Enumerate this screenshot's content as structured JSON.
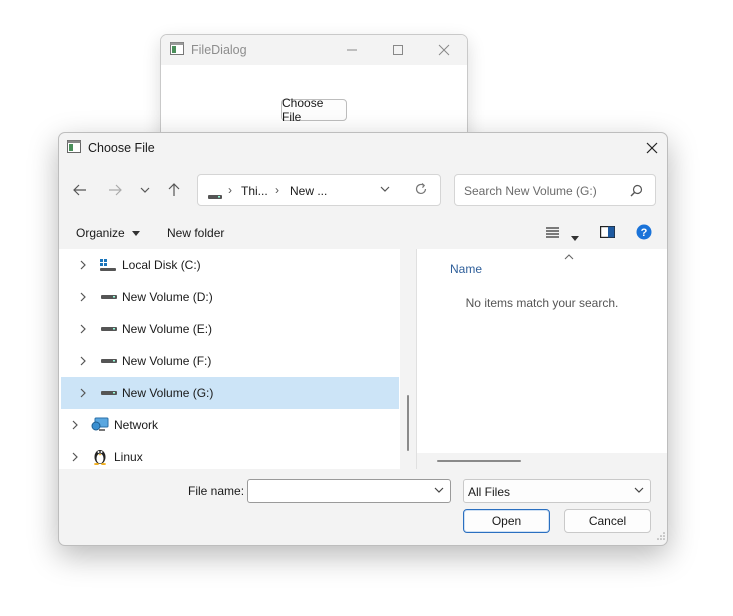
{
  "parent_window": {
    "title": "FileDialog",
    "button_label": "Choose File"
  },
  "dialog": {
    "title": "Choose File",
    "breadcrumbs": [
      "Thi...",
      "New ..."
    ],
    "search_placeholder": "Search New Volume (G:)",
    "toolbar": {
      "organize_label": "Organize",
      "new_folder_label": "New folder"
    },
    "nav_items": [
      {
        "label": "Local Disk (C:)",
        "icon": "local-disk-icon",
        "selected": false
      },
      {
        "label": "New Volume (D:)",
        "icon": "drive-icon",
        "selected": false
      },
      {
        "label": "New Volume (E:)",
        "icon": "drive-icon",
        "selected": false
      },
      {
        "label": "New Volume (F:)",
        "icon": "drive-icon",
        "selected": false
      },
      {
        "label": "New Volume (G:)",
        "icon": "drive-icon",
        "selected": true
      },
      {
        "label": "Network",
        "icon": "network-icon",
        "selected": false
      },
      {
        "label": "Linux",
        "icon": "linux-penguin-icon",
        "selected": false
      }
    ],
    "content": {
      "column_name": "Name",
      "empty_message": "No items match your search."
    },
    "footer": {
      "file_name_label": "File name:",
      "file_name_value": "",
      "file_type_selected": "All Files",
      "open_label": "Open",
      "cancel_label": "Cancel"
    }
  },
  "colors": {
    "selection": "#cce4f7",
    "accent": "#2a6fc0",
    "link_text": "#2f5f9a",
    "help": "#1a73d9"
  }
}
